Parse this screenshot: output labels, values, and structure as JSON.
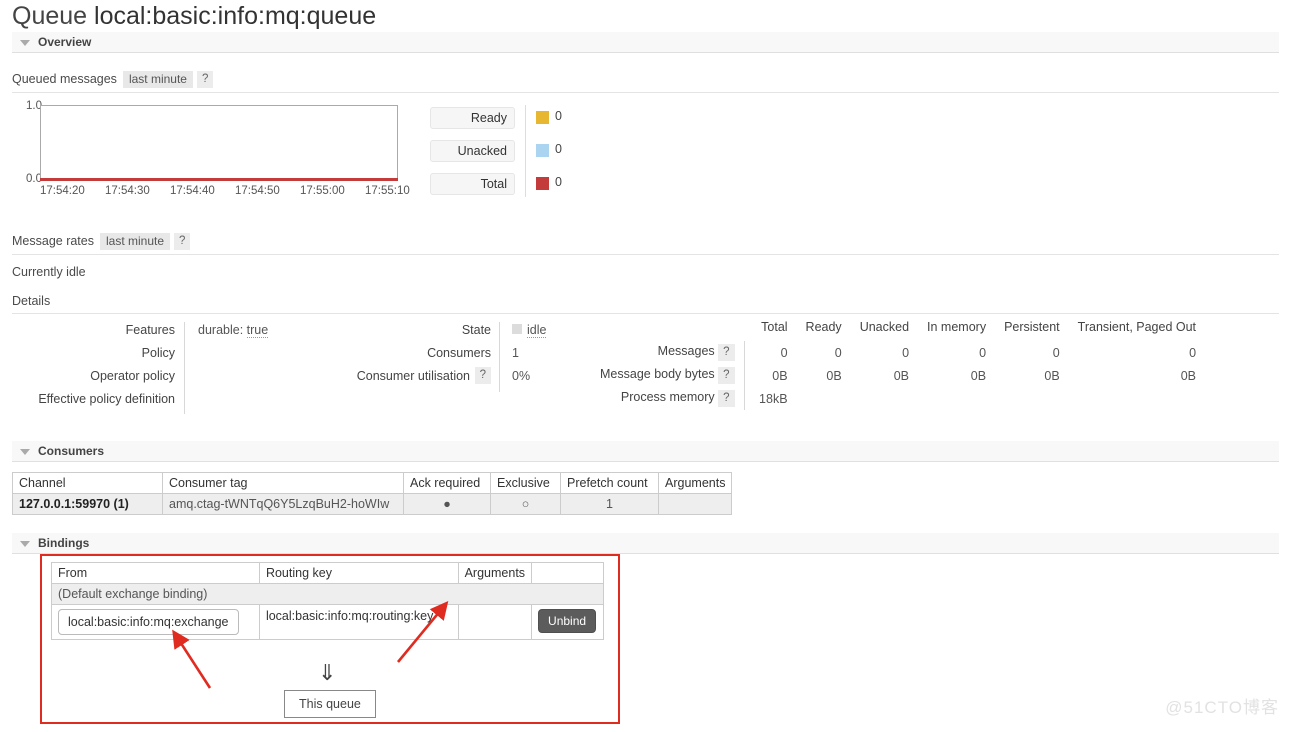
{
  "page": {
    "title_prefix": "Queue",
    "queue_name": "local:basic:info:mq:queue",
    "watermark": "@51CTO博客"
  },
  "sections": {
    "overview": "Overview",
    "consumers": "Consumers",
    "bindings": "Bindings"
  },
  "queued_messages": {
    "label": "Queued messages",
    "period": "last minute",
    "help": "?"
  },
  "message_rates": {
    "label": "Message rates",
    "period": "last minute",
    "help": "?",
    "status": "Currently idle"
  },
  "details_label": "Details",
  "chart_data": {
    "type": "line",
    "title": "Queued messages",
    "xlabel": "",
    "ylabel": "",
    "ylim": [
      0.0,
      1.0
    ],
    "ytick_labels": [
      "1.0",
      "0.0"
    ],
    "x": [
      "17:54:20",
      "17:54:30",
      "17:54:40",
      "17:54:50",
      "17:55:00",
      "17:55:10"
    ],
    "grid": false,
    "legend_position": "right",
    "series": [
      {
        "name": "Ready",
        "color": "#e8b732",
        "values": [
          0,
          0,
          0,
          0,
          0,
          0
        ],
        "current": "0"
      },
      {
        "name": "Unacked",
        "color": "#aad4f0",
        "values": [
          0,
          0,
          0,
          0,
          0,
          0
        ],
        "current": "0"
      },
      {
        "name": "Total",
        "color": "#c43b3b",
        "values": [
          0,
          0,
          0,
          0,
          0,
          0
        ],
        "current": "0"
      }
    ]
  },
  "details_left": {
    "rows": [
      {
        "label": "Features",
        "value": "durable: true",
        "dotted_word": "true"
      },
      {
        "label": "Policy",
        "value": ""
      },
      {
        "label": "Operator policy",
        "value": ""
      },
      {
        "label": "Effective policy definition",
        "value": ""
      }
    ]
  },
  "details_mid": {
    "rows": [
      {
        "label": "State",
        "value": "idle",
        "has_square": true
      },
      {
        "label": "Consumers",
        "value": "1",
        "has_square": false
      },
      {
        "label": "Consumer utilisation",
        "value": "0%",
        "help": "?",
        "has_square": false
      }
    ]
  },
  "stats": {
    "columns": [
      "Total",
      "Ready",
      "Unacked",
      "In memory",
      "Persistent",
      "Transient, Paged Out"
    ],
    "rows": [
      {
        "label": "Messages",
        "help": "?",
        "values": [
          "0",
          "0",
          "0",
          "0",
          "0",
          "0"
        ]
      },
      {
        "label": "Message body bytes",
        "help": "?",
        "values": [
          "0B",
          "0B",
          "0B",
          "0B",
          "0B",
          "0B"
        ]
      },
      {
        "label": "Process memory",
        "help": "?",
        "values": [
          "18kB",
          "",
          "",
          "",
          "",
          ""
        ]
      }
    ]
  },
  "consumers_table": {
    "columns": [
      "Channel",
      "Consumer tag",
      "Ack required",
      "Exclusive",
      "Prefetch count",
      "Arguments"
    ],
    "rows": [
      {
        "channel": "127.0.0.1:59970 (1)",
        "consumer_tag": "amq.ctag-tWNTqQ6Y5LzqBuH2-hoWIw",
        "ack_required": "●",
        "exclusive": "○",
        "prefetch_count": "1",
        "arguments": ""
      }
    ]
  },
  "bindings_table": {
    "columns": [
      "From",
      "Routing key",
      "Arguments",
      ""
    ],
    "default_row": "(Default exchange binding)",
    "rows": [
      {
        "from": "local:basic:info:mq:exchange",
        "routing_key": "local:basic:info:mq:routing:key",
        "arguments": "",
        "action": "Unbind"
      }
    ],
    "this_queue": "This queue",
    "arrow": "⇓"
  }
}
